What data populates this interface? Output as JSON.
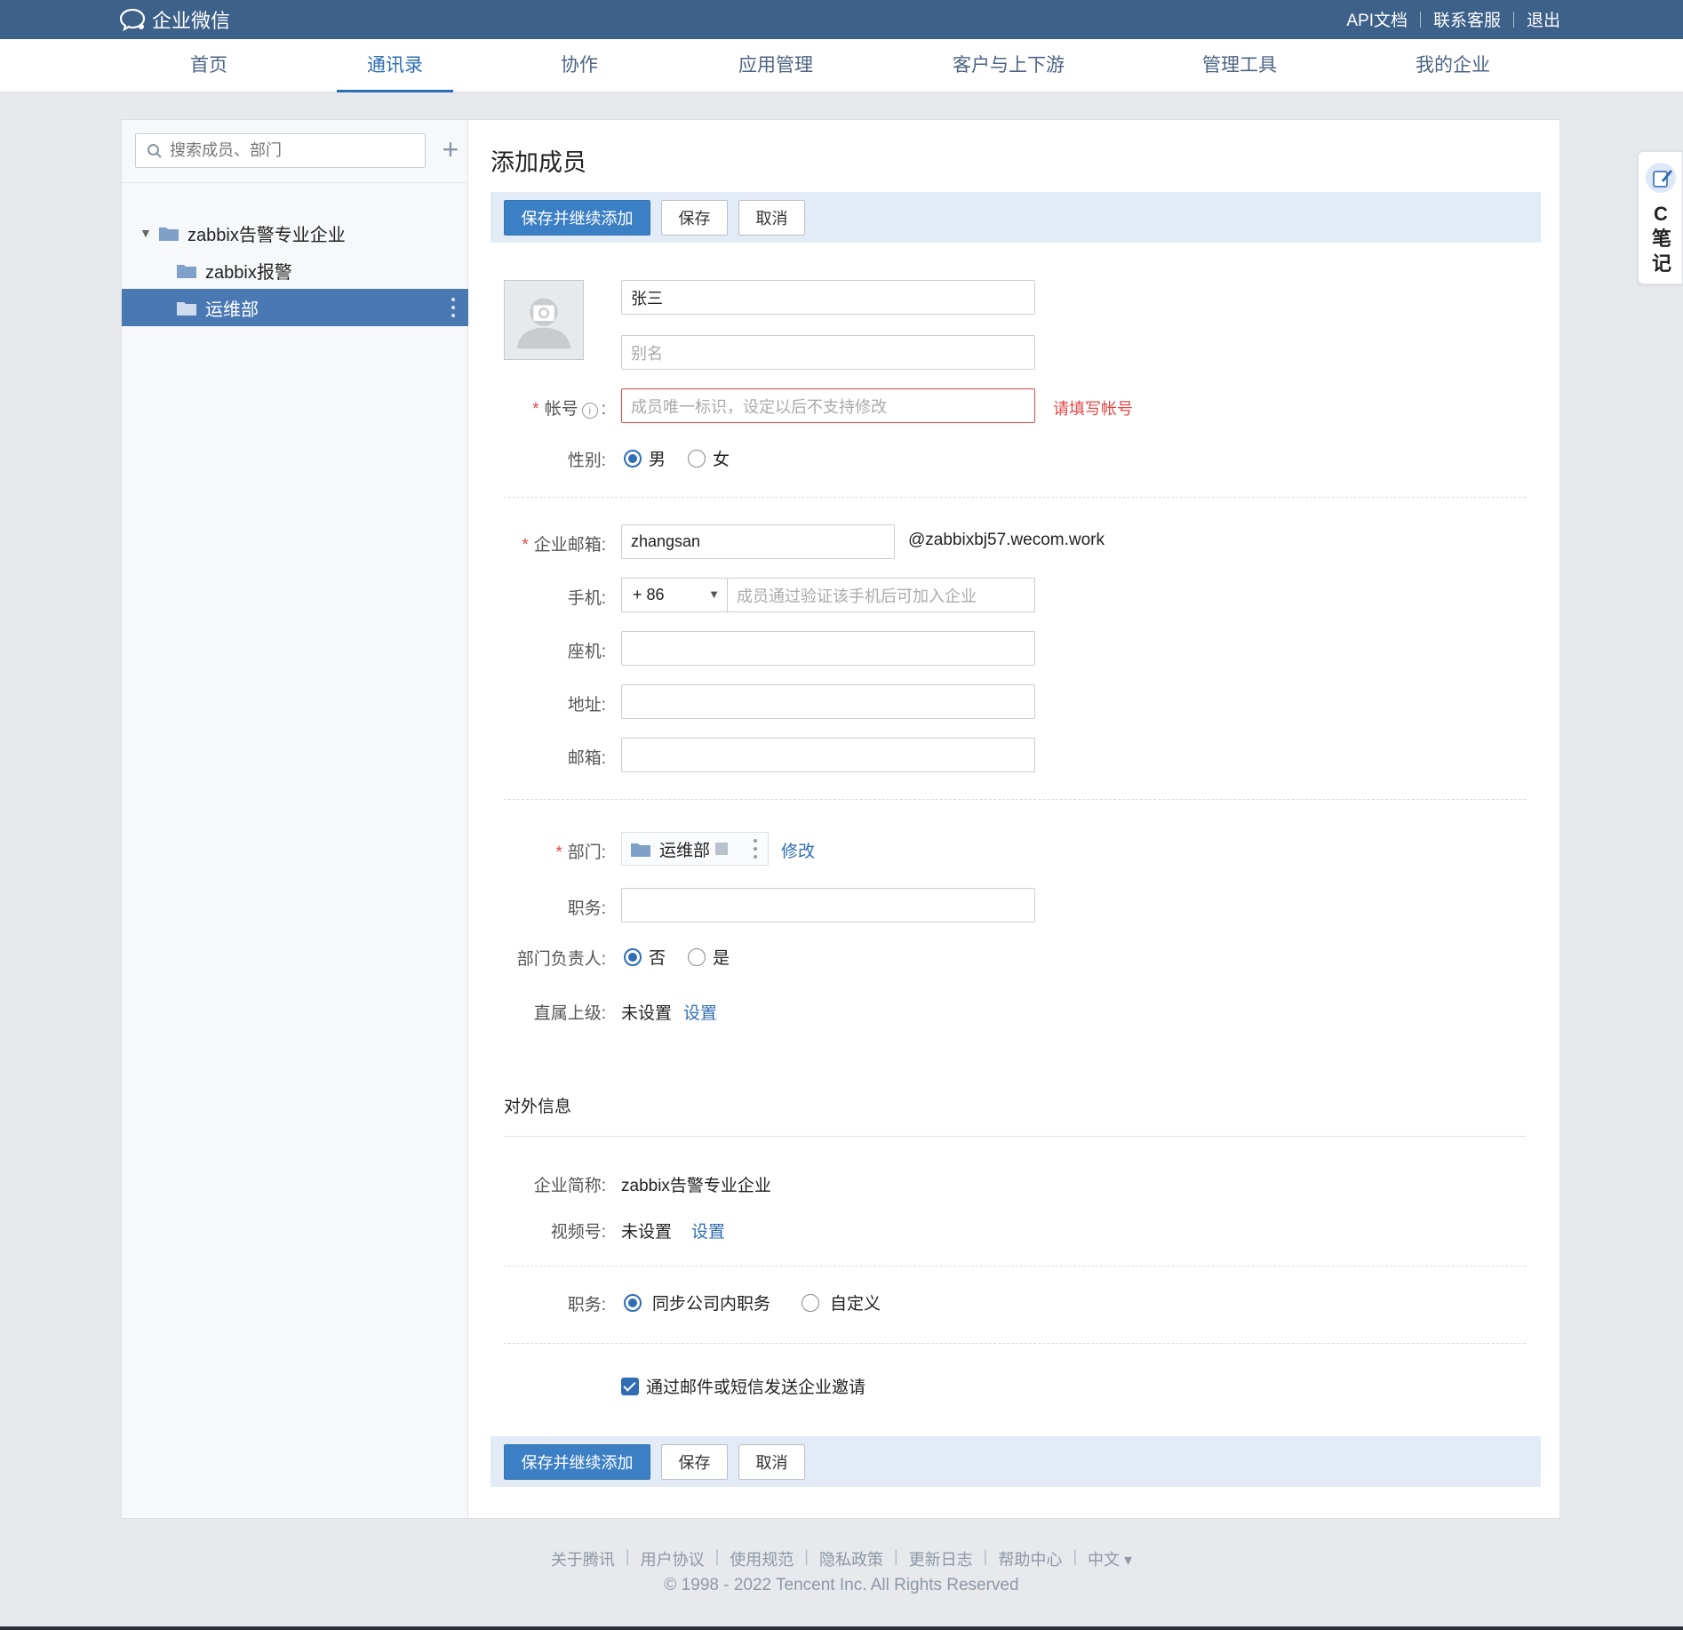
{
  "topbar": {
    "logo_text": "企业微信",
    "links": [
      "API文档",
      "联系客服",
      "退出"
    ]
  },
  "nav": {
    "items": [
      "首页",
      "通讯录",
      "协作",
      "应用管理",
      "客户与上下游",
      "管理工具",
      "我的企业"
    ],
    "active": "通讯录"
  },
  "sidebar": {
    "search_placeholder": "搜索成员、部门",
    "tree": [
      "zabbix告警专业企业",
      "zabbix报警",
      "运维部"
    ],
    "selected": "运维部"
  },
  "form": {
    "title": "添加成员",
    "buttons": {
      "save_continue": "保存并继续添加",
      "save": "保存",
      "cancel": "取消"
    },
    "name_value": "张三",
    "alias_placeholder": "别名",
    "account_label": "帐号",
    "account_placeholder": "成员唯一标识，设定以后不支持修改",
    "account_error": "请填写帐号",
    "gender_label": "性别:",
    "gender_options": [
      "男",
      "女"
    ],
    "gender_selected": "男",
    "email_label": "企业邮箱:",
    "email_value": "zhangsan",
    "email_domain": "@zabbixbj57.wecom.work",
    "mobile_label": "手机:",
    "mobile_code": "+ 86",
    "mobile_placeholder": "成员通过验证该手机后可加入企业",
    "phone_label": "座机:",
    "address_label": "地址:",
    "mailbox_label": "邮箱:",
    "dept_label": "部门:",
    "dept_value": "运维部",
    "dept_modify": "修改",
    "position_label": "职务:",
    "leader_label": "部门负责人:",
    "leader_options": [
      "否",
      "是"
    ],
    "leader_selected": "否",
    "superior_label": "直属上级:",
    "superior_value": "未设置",
    "superior_link": "设置",
    "external_section": "对外信息",
    "corp_short_label": "企业简称:",
    "corp_short_value": "zabbix告警专业企业",
    "channel_label": "视频号:",
    "channel_value": "未设置",
    "channel_link": "设置",
    "ext_position_label": "职务:",
    "ext_position_options": [
      "同步公司内职务",
      "自定义"
    ],
    "ext_position_selected": "同步公司内职务",
    "invite_label": "通过邮件或短信发送企业邀请",
    "invite_checked": true
  },
  "footer": {
    "links": [
      "关于腾讯",
      "用户协议",
      "使用规范",
      "隐私政策",
      "更新日志",
      "帮助中心",
      "中文 ▾"
    ],
    "copyright": "© 1998 - 2022 Tencent Inc. All Rights Reserved"
  },
  "note_widget": {
    "text": "C笔记"
  },
  "colors": {
    "topbar": "#3d6189",
    "accent": "#2f6db5",
    "primary_button": "#3b7fc4",
    "error": "#e04848"
  }
}
